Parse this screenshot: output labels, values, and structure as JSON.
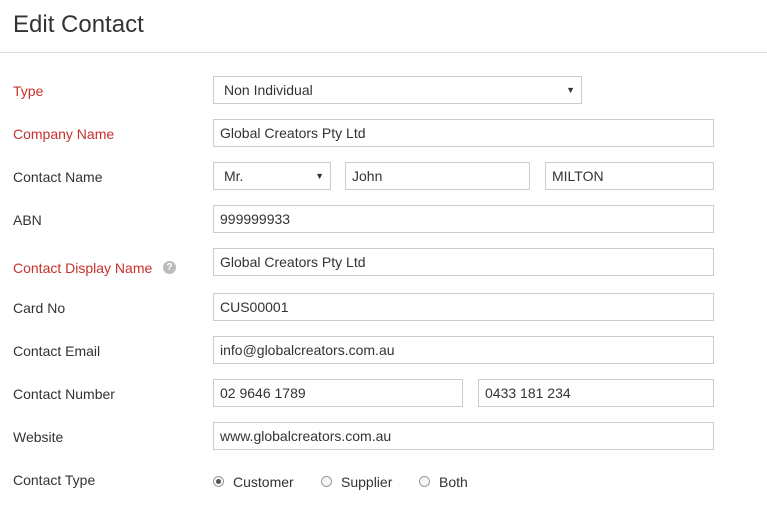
{
  "page": {
    "title": "Edit Contact"
  },
  "form": {
    "type": {
      "label": "Type",
      "value": "Non Individual"
    },
    "company_name": {
      "label": "Company Name",
      "value": "Global Creators Pty Ltd"
    },
    "contact_name": {
      "label": "Contact Name",
      "salutation": "Mr.",
      "first_name": "John",
      "last_name": "MILTON"
    },
    "abn": {
      "label": "ABN",
      "value": "999999933"
    },
    "display_name": {
      "label": "Contact Display Name",
      "value": "Global Creators Pty Ltd"
    },
    "card_no": {
      "label": "Card No",
      "value": "CUS00001"
    },
    "email": {
      "label": "Contact Email",
      "value": "info@globalcreators.com.au"
    },
    "number": {
      "label": "Contact Number",
      "phone": "02 9646 1789",
      "mobile": "0433 181 234"
    },
    "website": {
      "label": "Website",
      "value": "www.globalcreators.com.au"
    },
    "contact_type": {
      "label": "Contact Type",
      "selected": "Customer",
      "options": [
        {
          "label": "Customer"
        },
        {
          "label": "Supplier"
        },
        {
          "label": "Both"
        }
      ]
    }
  },
  "icons": {
    "help": "question-circle-icon",
    "caret": "caret-down-icon"
  },
  "colors": {
    "required_label": "#c9302c",
    "border": "#cccccc",
    "text": "#333333"
  }
}
